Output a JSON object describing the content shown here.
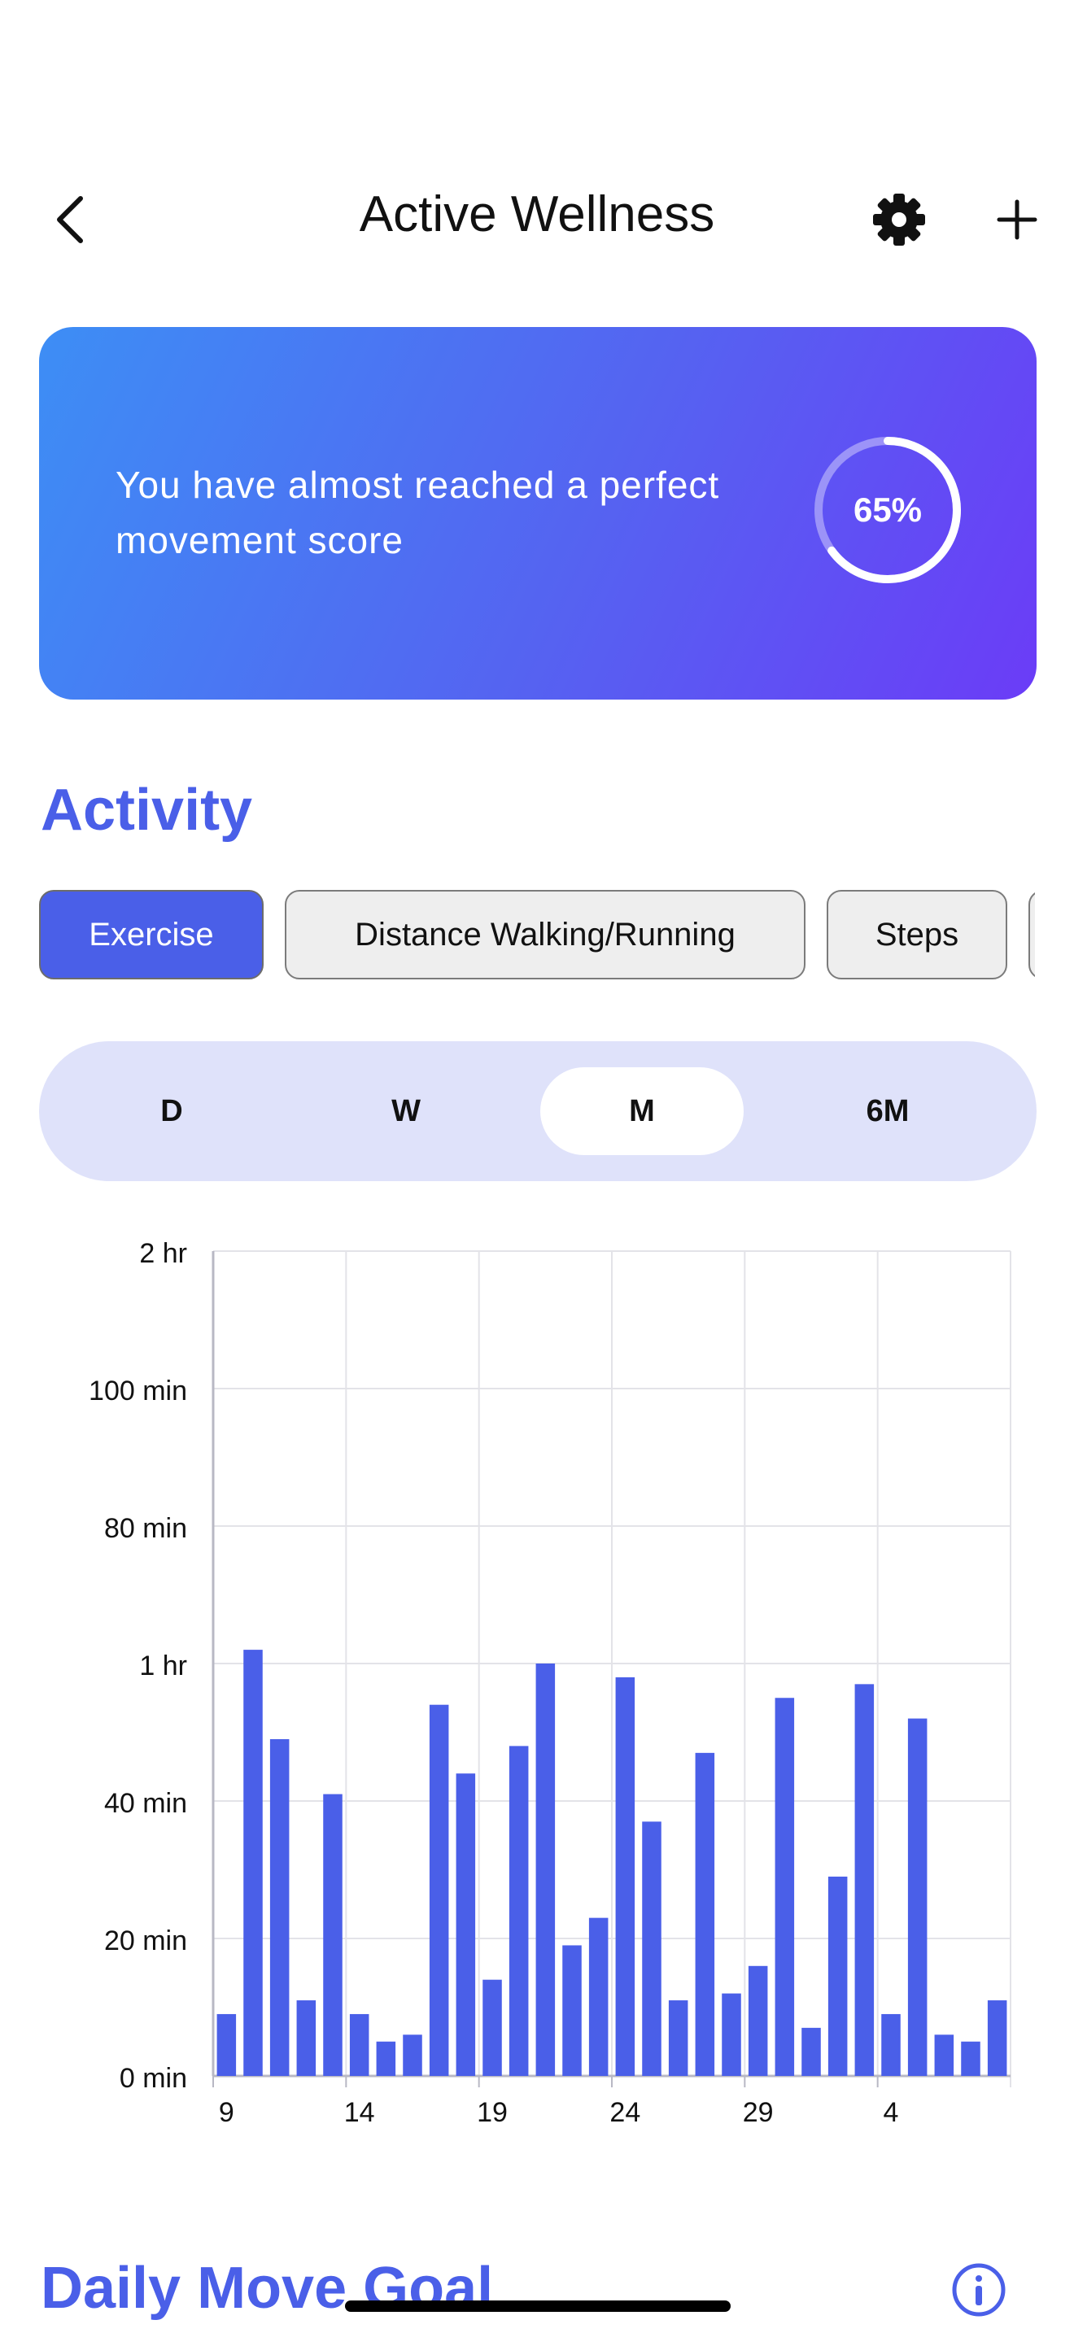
{
  "header": {
    "title": "Active Wellness",
    "back_icon": "chevron-left-icon",
    "settings_icon": "gear-icon",
    "add_icon": "plus-icon"
  },
  "banner": {
    "message": "You have almost reached a perfect movement score",
    "score_label": "65%",
    "score_progress": 0.65,
    "gradient_start": "#3d8ef5",
    "gradient_end": "#6b3cf7"
  },
  "activity": {
    "title": "Activity",
    "chips": [
      "Exercise",
      "Distance Walking/Running",
      "Steps"
    ],
    "selected_chip": "Exercise"
  },
  "range": {
    "options": [
      "D",
      "W",
      "M",
      "6M"
    ],
    "selected": "M"
  },
  "chart_data": {
    "type": "bar",
    "ylim": [
      0,
      120
    ],
    "y_ticks": [
      {
        "value": 0,
        "label": "0 min"
      },
      {
        "value": 20,
        "label": "20 min"
      },
      {
        "value": 40,
        "label": "40 min"
      },
      {
        "value": 60,
        "label": "1 hr"
      },
      {
        "value": 80,
        "label": "80  min"
      },
      {
        "value": 100,
        "label": "100  min"
      },
      {
        "value": 120,
        "label": "2 hr"
      }
    ],
    "x_ticks": [
      "9",
      "14",
      "19",
      "24",
      "29",
      "4"
    ],
    "x_tick_indices": [
      0,
      5,
      10,
      15,
      20,
      25
    ],
    "grid": true,
    "values": [
      9,
      62,
      49,
      11,
      41,
      9,
      5,
      6,
      54,
      44,
      14,
      48,
      60,
      19,
      23,
      58,
      37,
      11,
      47,
      12,
      16,
      55,
      7,
      29,
      57,
      9,
      52,
      6,
      5,
      11
    ],
    "color": "#4a5fe8"
  },
  "daily_goal": {
    "title": "Daily Move Goal",
    "info_icon": "info-icon"
  }
}
